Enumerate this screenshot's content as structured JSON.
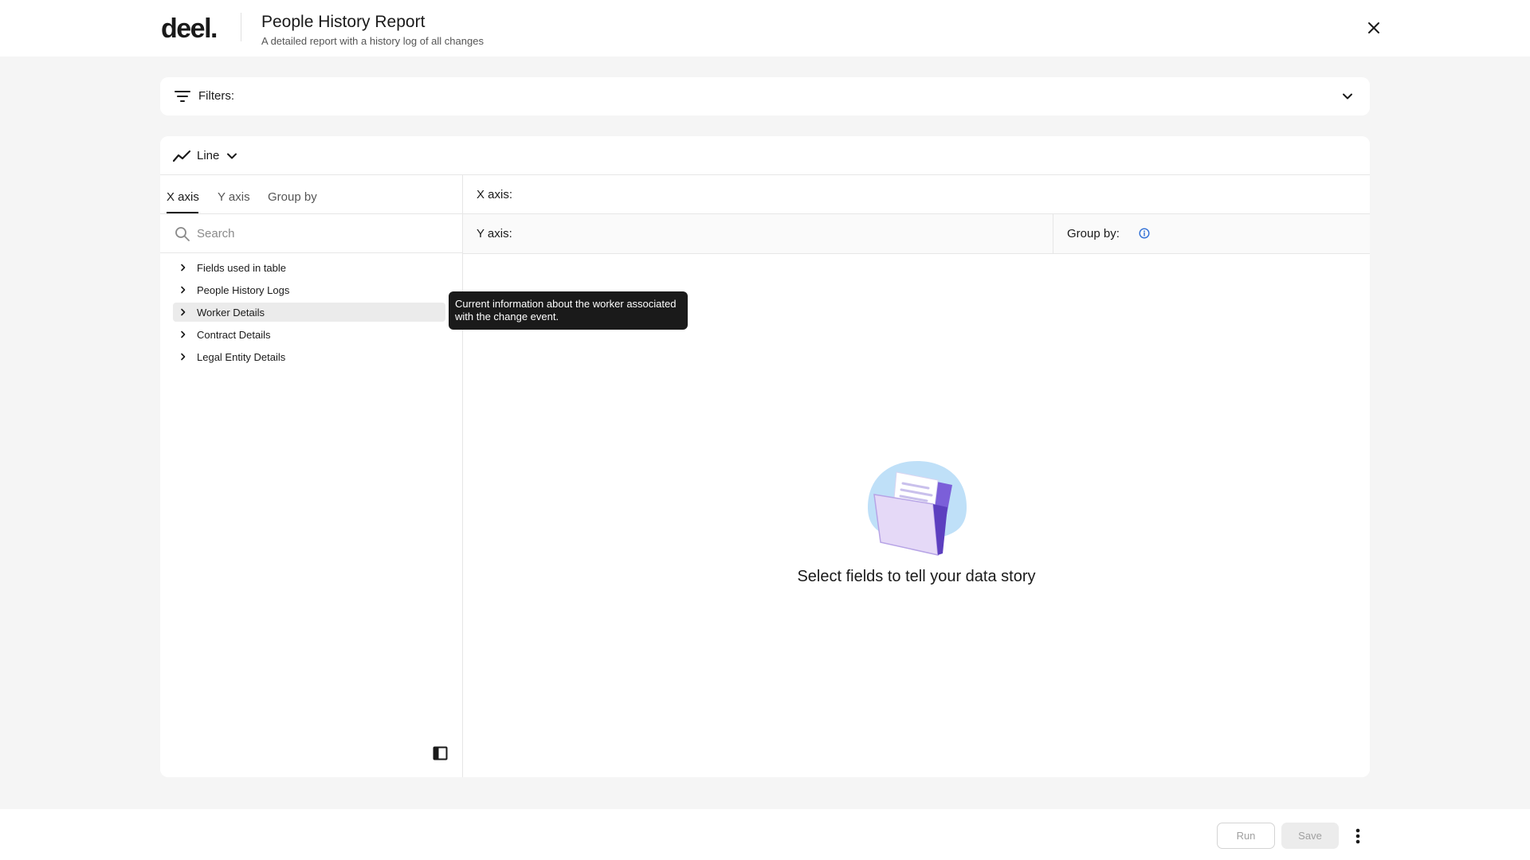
{
  "header": {
    "logo": "deel.",
    "title": "People History Report",
    "subtitle": "A detailed report with a history log of all changes",
    "close_icon": "close-icon"
  },
  "filters": {
    "label": "Filters:",
    "icon": "filter-icon",
    "toggle_icon": "chevron-down-icon"
  },
  "chart_type": {
    "label": "Line",
    "icon": "line-chart-icon"
  },
  "tabs": [
    {
      "label": "X axis",
      "active": true
    },
    {
      "label": "Y axis",
      "active": false
    },
    {
      "label": "Group by",
      "active": false
    }
  ],
  "search": {
    "placeholder": "Search"
  },
  "tree": [
    {
      "label": "Fields used in table"
    },
    {
      "label": "People History Logs"
    },
    {
      "label": "Worker Details",
      "hovered": true
    },
    {
      "label": "Contract Details"
    },
    {
      "label": "Legal Entity Details"
    }
  ],
  "tooltip": {
    "line1": "Current information about the worker associated",
    "line2": "with the change event."
  },
  "axes": {
    "x_label": "X axis:",
    "y_label": "Y axis:",
    "group_by_label": "Group by:"
  },
  "empty_state": {
    "message": "Select fields to tell your data story",
    "illustration": "folder-illustration"
  },
  "footer": {
    "run_label": "Run",
    "save_label": "Save",
    "more_icon": "more-vertical-icon"
  },
  "colors": {
    "background": "#f5f5f5",
    "info_accent": "#2f6fd6",
    "illustration_blue": "#bfe0f8",
    "illustration_purple": "#7b5fd9"
  }
}
